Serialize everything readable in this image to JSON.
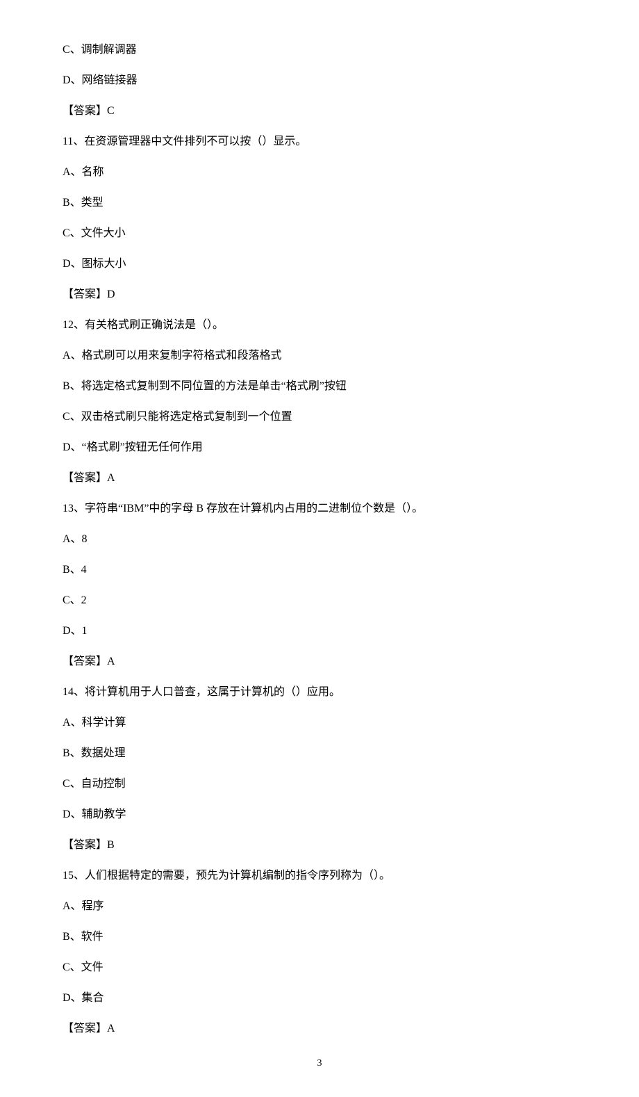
{
  "q10": {
    "optC": "C、调制解调器",
    "optD": "D、网络链接器",
    "answer": "【答案】C"
  },
  "q11": {
    "stem": "11、在资源管理器中文件排列不可以按（）显示。",
    "optA": "A、名称",
    "optB": "B、类型",
    "optC": "C、文件大小",
    "optD": "D、图标大小",
    "answer": "【答案】D"
  },
  "q12": {
    "stem": "12、有关格式刷正确说法是（）。",
    "optA": "A、格式刷可以用来复制字符格式和段落格式",
    "optB": "B、将选定格式复制到不同位置的方法是单击“格式刷”按钮",
    "optC": "C、双击格式刷只能将选定格式复制到一个位置",
    "optD": "D、“格式刷”按钮无任何作用",
    "answer": "【答案】A"
  },
  "q13": {
    "stem": "13、字符串“IBM”中的字母 B 存放在计算机内占用的二进制位个数是（）。",
    "optA": "A、8",
    "optB": "B、4",
    "optC": "C、2",
    "optD": "D、1",
    "answer": "【答案】A"
  },
  "q14": {
    "stem": "14、将计算机用于人口普查，这属于计算机的（）应用。",
    "optA": "A、科学计算",
    "optB": "B、数据处理",
    "optC": "C、自动控制",
    "optD": "D、辅助教学",
    "answer": "【答案】B"
  },
  "q15": {
    "stem": "15、人们根据特定的需要，预先为计算机编制的指令序列称为（）。",
    "optA": "A、程序",
    "optB": "B、软件",
    "optC": "C、文件",
    "optD": "D、集合",
    "answer": "【答案】A"
  },
  "pageNumber": "3"
}
